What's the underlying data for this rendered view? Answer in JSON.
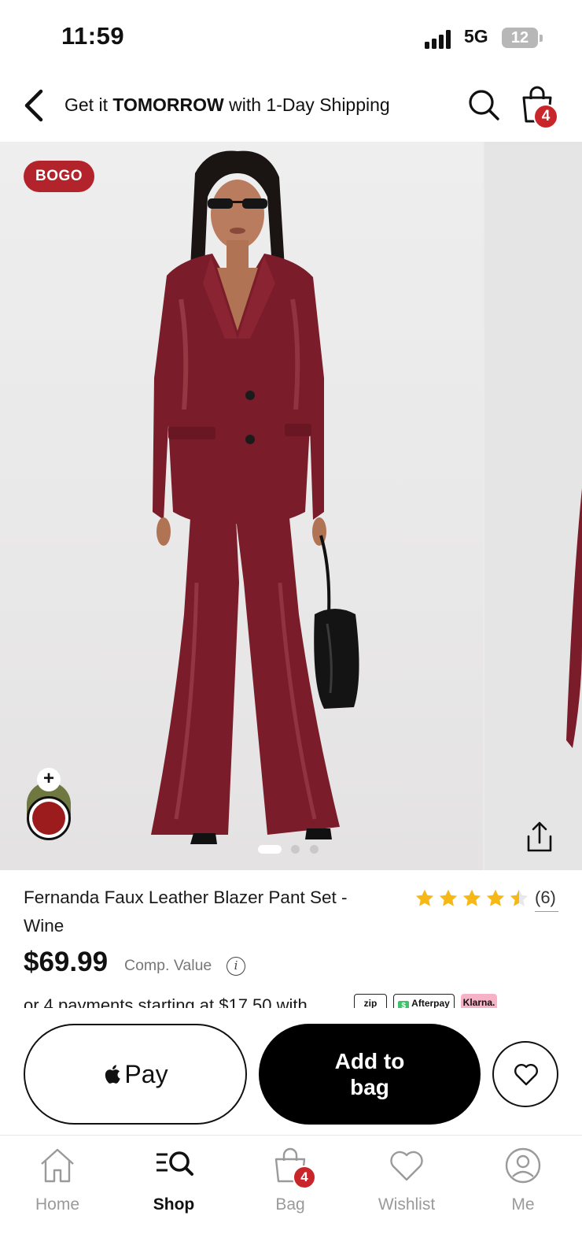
{
  "status_bar": {
    "time": "11:59",
    "network": "5G",
    "battery": "12"
  },
  "header": {
    "shipping_prefix": "Get it ",
    "shipping_emphasis": "TOMORROW",
    "shipping_suffix": " with 1-Day Shipping",
    "bag_count": "4"
  },
  "gallery": {
    "badge": "BOGO",
    "total_images": 3,
    "active_index": 0,
    "swatch_plus": "+",
    "swatches": [
      {
        "name": "olive",
        "color": "#6e7840"
      },
      {
        "name": "wine",
        "color": "#9c1c1e",
        "selected": true
      }
    ],
    "product_color": "#7a1c2a"
  },
  "product": {
    "title": "Fernanda Faux Leather Blazer Pant Set - Wine",
    "rating": 4.5,
    "review_count": "(6)",
    "price": "$69.99",
    "comp_value_label": "Comp. Value",
    "info_icon": "i",
    "payments_text": "or 4 payments starting at $17.50 with",
    "payment_providers": [
      "zip",
      "Afterpay",
      "Klarna."
    ]
  },
  "actions": {
    "apple_pay_label": "Pay",
    "add_to_bag_label": "Add to bag"
  },
  "tabbar": {
    "items": [
      {
        "label": "Home",
        "icon": "home-icon",
        "active": false
      },
      {
        "label": "Shop",
        "icon": "shop-search-icon",
        "active": true
      },
      {
        "label": "Bag",
        "icon": "bag-icon",
        "active": false
      },
      {
        "label": "Wishlist",
        "icon": "heart-icon",
        "active": false
      },
      {
        "label": "Me",
        "icon": "user-icon",
        "active": false
      }
    ],
    "bag_count": "4"
  },
  "colors": {
    "accent_red": "#c8262b",
    "bogo_red": "#b3232b",
    "star_gold": "#f5b817",
    "black": "#000000"
  }
}
